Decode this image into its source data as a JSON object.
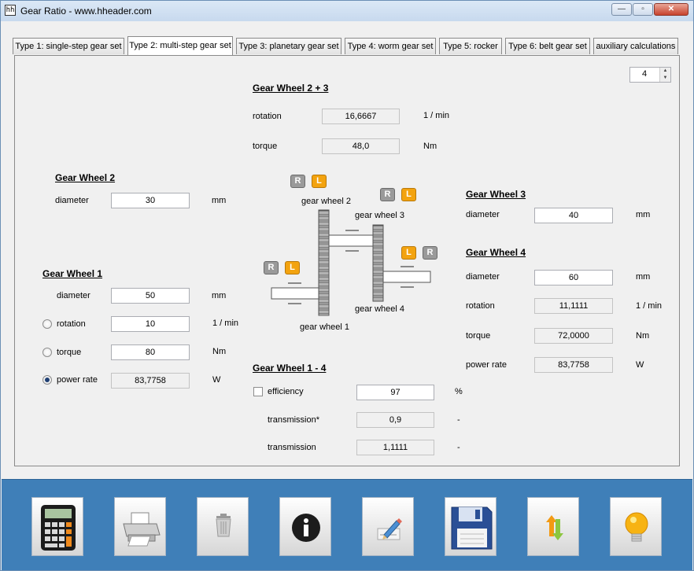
{
  "window": {
    "title": "Gear Ratio - www.hheader.com",
    "app_icon": "hh-icon"
  },
  "tabs": [
    {
      "label": "Type 1: single-step gear set"
    },
    {
      "label": "Type 2: multi-step gear set",
      "active": true
    },
    {
      "label": "Type 3: planetary gear set"
    },
    {
      "label": "Type 4: worm gear set"
    },
    {
      "label": "Type 5: rocker"
    },
    {
      "label": "Type 6: belt gear set"
    },
    {
      "label": "auxiliary calculations"
    }
  ],
  "spinner": {
    "value": "4"
  },
  "gw23": {
    "title": "Gear Wheel 2 + 3",
    "rotation_label": "rotation",
    "rotation_value": "16,6667",
    "rotation_unit": "1 / min",
    "torque_label": "torque",
    "torque_value": "48,0",
    "torque_unit": "Nm"
  },
  "gw2": {
    "title": "Gear Wheel 2",
    "diameter_label": "diameter",
    "diameter_value": "30",
    "diameter_unit": "mm"
  },
  "gw1": {
    "title": "Gear Wheel 1",
    "diameter_label": "diameter",
    "diameter_value": "50",
    "diameter_unit": "mm",
    "rotation_label": "rotation",
    "rotation_value": "10",
    "rotation_unit": "1 / min",
    "torque_label": "torque",
    "torque_value": "80",
    "torque_unit": "Nm",
    "power_label": "power rate",
    "power_value": "83,7758",
    "power_unit": "W",
    "selected_input": "power rate"
  },
  "gw3": {
    "title": "Gear Wheel 3",
    "diameter_label": "diameter",
    "diameter_value": "40",
    "diameter_unit": "mm"
  },
  "gw4": {
    "title": "Gear Wheel 4",
    "diameter_label": "diameter",
    "diameter_value": "60",
    "diameter_unit": "mm",
    "rotation_label": "rotation",
    "rotation_value": "11,1111",
    "rotation_unit": "1 / min",
    "torque_label": "torque",
    "torque_value": "72,0000",
    "torque_unit": "Nm",
    "power_label": "power rate",
    "power_value": "83,7758",
    "power_unit": "W"
  },
  "gw14": {
    "title": "Gear Wheel 1 - 4",
    "efficiency_label": "efficiency",
    "efficiency_value": "97",
    "efficiency_unit": "%",
    "efficiency_checked": false,
    "transmission_star_label": "transmission*",
    "transmission_star_value": "0,9",
    "transmission_star_unit": "-",
    "transmission_label": "transmission",
    "transmission_value": "1,1111",
    "transmission_unit": "-"
  },
  "diagram": {
    "label_gw2": "gear wheel 2",
    "label_gw3": "gear wheel 3",
    "label_gw4": "gear wheel 4",
    "label_gw1": "gear wheel 1",
    "badge_r": "R",
    "badge_l": "L"
  },
  "toolbar": {
    "buttons": [
      "calculator-icon",
      "printer-icon",
      "trash-icon",
      "info-icon",
      "edit-icon",
      "save-icon",
      "swap-icon",
      "lightbulb-icon"
    ]
  }
}
